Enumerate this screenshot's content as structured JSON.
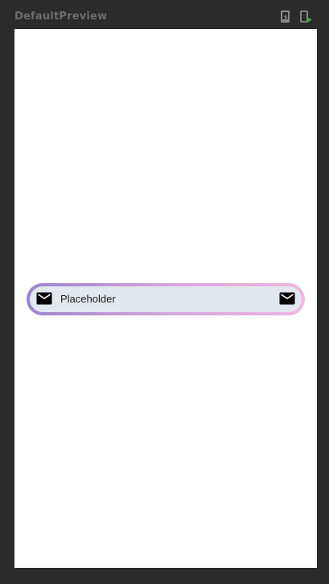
{
  "preview": {
    "title": "DefaultPreview"
  },
  "toolbar": {
    "deploy_icon": "deploy-preview-icon",
    "interactive_icon": "interactive-mode-icon",
    "interactive_accent": "#3fa34d"
  },
  "text_field": {
    "placeholder": "Placeholder",
    "value": "",
    "leading_icon": "mail-icon",
    "trailing_icon": "mail-icon",
    "background": "#e2e8ee",
    "border_gradient": [
      "#9b84cf",
      "#d3a6dc",
      "#f3b6e0"
    ]
  }
}
